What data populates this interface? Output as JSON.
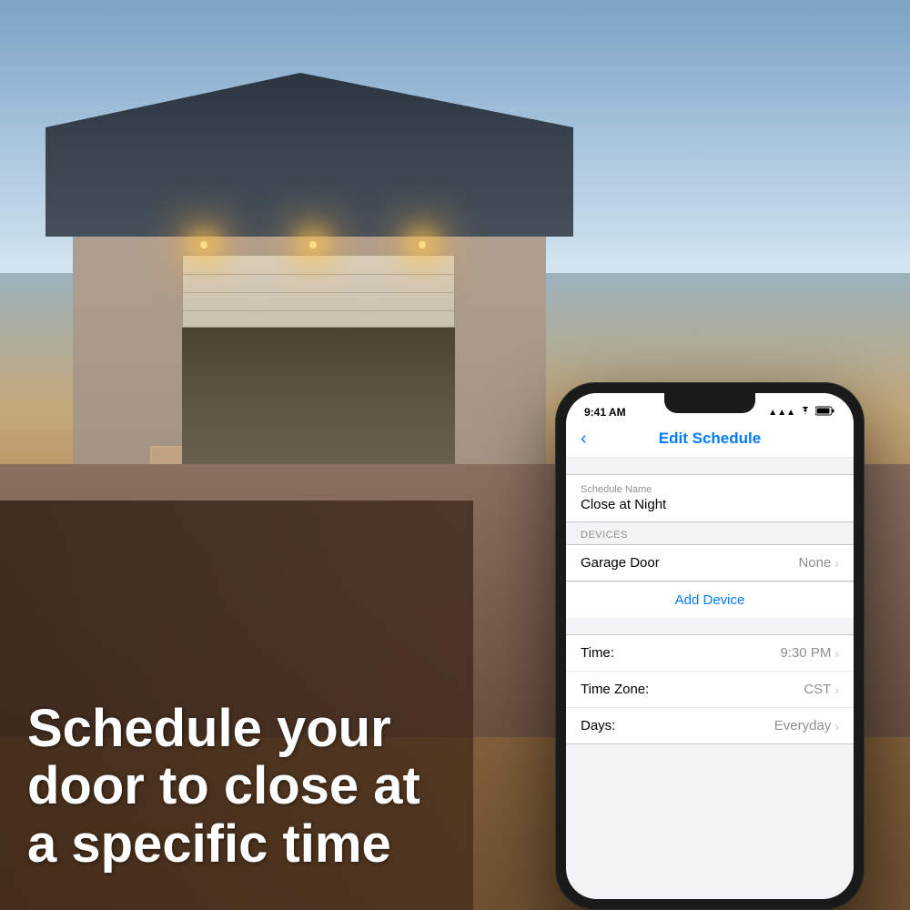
{
  "background": {
    "alt": "House with garage door at night"
  },
  "marketing": {
    "headline": "Schedule your door to close at a specific time"
  },
  "phone": {
    "status_bar": {
      "time": "9:41 AM",
      "signal": "●●●",
      "wifi": "WiFi",
      "battery": "Battery"
    },
    "nav": {
      "back_label": "‹",
      "title": "Edit Schedule"
    },
    "schedule_name_section": {
      "label": "Schedule Name",
      "value": "Close at Night"
    },
    "devices_section": {
      "label": "DEVICES",
      "device_name": "Garage Door",
      "device_value": "None",
      "add_device_label": "Add Device"
    },
    "settings": [
      {
        "label": "Time:",
        "value": "9:30 PM"
      },
      {
        "label": "Time Zone:",
        "value": "CST"
      },
      {
        "label": "Days:",
        "value": "Everyday"
      }
    ]
  }
}
